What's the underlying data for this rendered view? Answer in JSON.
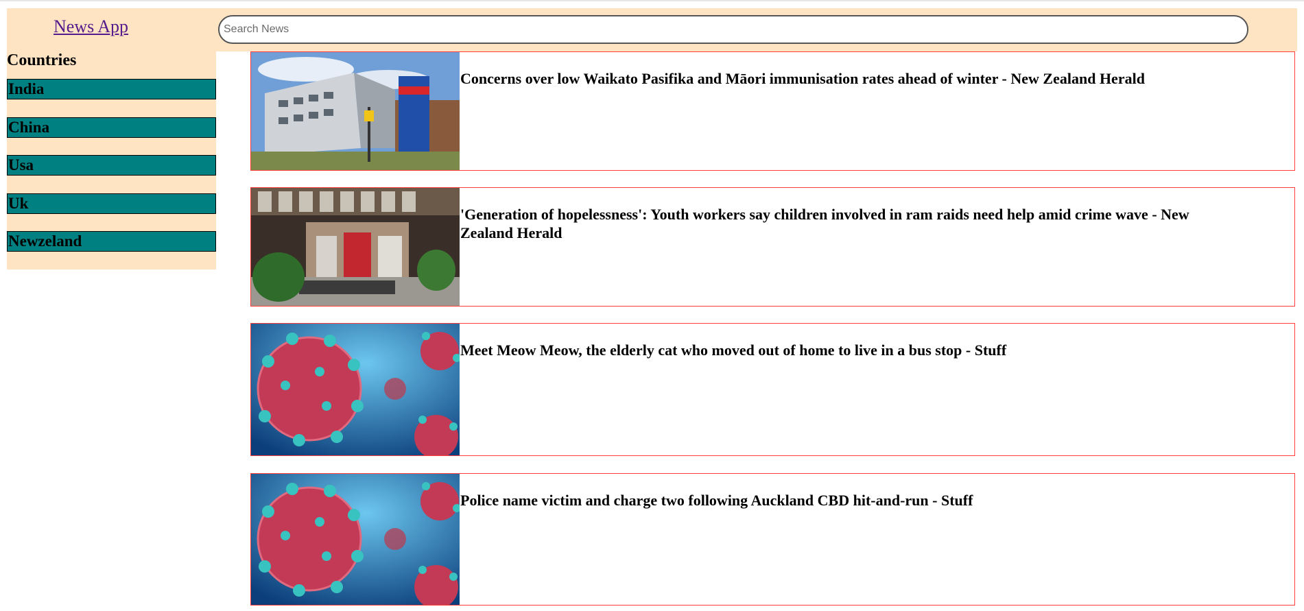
{
  "header": {
    "app_title": "News App",
    "search_placeholder": "Search News"
  },
  "sidebar": {
    "title": "Countries",
    "countries": [
      "India",
      "China",
      "Usa",
      "Uk",
      "Newzeland"
    ]
  },
  "articles": [
    {
      "title": "Concerns over low Waikato Pasifika and Māori immunisation rates ahead of winter - New Zealand Herald",
      "image": "hospital-emergency-photo"
    },
    {
      "title": "'Generation of hopelessness': Youth workers say children involved in ram raids need help amid crime wave - New Zealand Herald",
      "image": "mall-entrance-photo"
    },
    {
      "title": "Meet Meow Meow, the elderly cat who moved out of home to live in a bus stop - Stuff",
      "image": "virus-illustration"
    },
    {
      "title": "Police name victim and charge two following Auckland CBD hit-and-run - Stuff",
      "image": "virus-illustration"
    }
  ],
  "colors": {
    "panel_bg": "#ffe4c4",
    "country_bg": "#008080",
    "card_border": "#ff3b3b",
    "link": "#551a8b"
  }
}
